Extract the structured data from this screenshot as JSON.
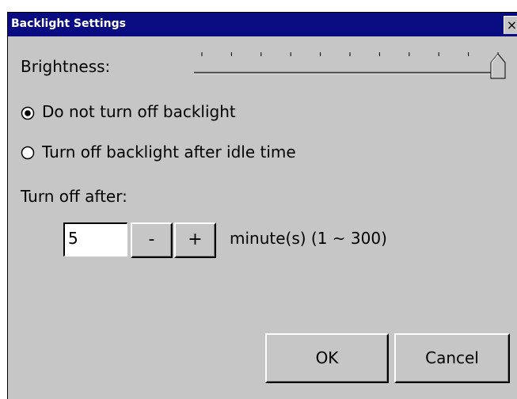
{
  "window": {
    "title": "Backlight Settings",
    "close_glyph": "×"
  },
  "brightness": {
    "label": "Brightness:",
    "value_fraction": 1.0,
    "tick_count": 11
  },
  "options": [
    {
      "label": "Do not turn off backlight",
      "selected": true
    },
    {
      "label": "Turn off backlight after idle time",
      "selected": false
    }
  ],
  "turn_off": {
    "label": "Turn off after:",
    "value": "5",
    "minus_label": "-",
    "plus_label": "+",
    "unit_text": "minute(s) (1 ~ 300)"
  },
  "buttons": {
    "ok": "OK",
    "cancel": "Cancel"
  },
  "colors": {
    "titlebar": "#090c80",
    "face": "#c6c6c6"
  }
}
